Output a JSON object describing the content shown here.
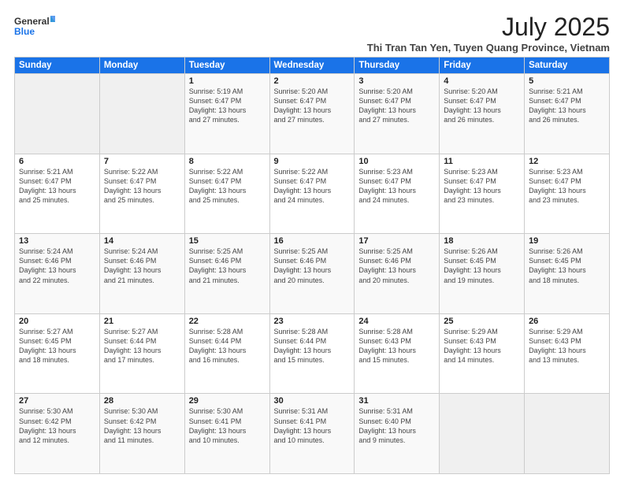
{
  "header": {
    "logo_line1": "General",
    "logo_line2": "Blue",
    "month_year": "July 2025",
    "location": "Thi Tran Tan Yen, Tuyen Quang Province, Vietnam"
  },
  "days_of_week": [
    "Sunday",
    "Monday",
    "Tuesday",
    "Wednesday",
    "Thursday",
    "Friday",
    "Saturday"
  ],
  "weeks": [
    [
      {
        "num": "",
        "info": ""
      },
      {
        "num": "",
        "info": ""
      },
      {
        "num": "1",
        "info": "Sunrise: 5:19 AM\nSunset: 6:47 PM\nDaylight: 13 hours\nand 27 minutes."
      },
      {
        "num": "2",
        "info": "Sunrise: 5:20 AM\nSunset: 6:47 PM\nDaylight: 13 hours\nand 27 minutes."
      },
      {
        "num": "3",
        "info": "Sunrise: 5:20 AM\nSunset: 6:47 PM\nDaylight: 13 hours\nand 27 minutes."
      },
      {
        "num": "4",
        "info": "Sunrise: 5:20 AM\nSunset: 6:47 PM\nDaylight: 13 hours\nand 26 minutes."
      },
      {
        "num": "5",
        "info": "Sunrise: 5:21 AM\nSunset: 6:47 PM\nDaylight: 13 hours\nand 26 minutes."
      }
    ],
    [
      {
        "num": "6",
        "info": "Sunrise: 5:21 AM\nSunset: 6:47 PM\nDaylight: 13 hours\nand 25 minutes."
      },
      {
        "num": "7",
        "info": "Sunrise: 5:22 AM\nSunset: 6:47 PM\nDaylight: 13 hours\nand 25 minutes."
      },
      {
        "num": "8",
        "info": "Sunrise: 5:22 AM\nSunset: 6:47 PM\nDaylight: 13 hours\nand 25 minutes."
      },
      {
        "num": "9",
        "info": "Sunrise: 5:22 AM\nSunset: 6:47 PM\nDaylight: 13 hours\nand 24 minutes."
      },
      {
        "num": "10",
        "info": "Sunrise: 5:23 AM\nSunset: 6:47 PM\nDaylight: 13 hours\nand 24 minutes."
      },
      {
        "num": "11",
        "info": "Sunrise: 5:23 AM\nSunset: 6:47 PM\nDaylight: 13 hours\nand 23 minutes."
      },
      {
        "num": "12",
        "info": "Sunrise: 5:23 AM\nSunset: 6:47 PM\nDaylight: 13 hours\nand 23 minutes."
      }
    ],
    [
      {
        "num": "13",
        "info": "Sunrise: 5:24 AM\nSunset: 6:46 PM\nDaylight: 13 hours\nand 22 minutes."
      },
      {
        "num": "14",
        "info": "Sunrise: 5:24 AM\nSunset: 6:46 PM\nDaylight: 13 hours\nand 21 minutes."
      },
      {
        "num": "15",
        "info": "Sunrise: 5:25 AM\nSunset: 6:46 PM\nDaylight: 13 hours\nand 21 minutes."
      },
      {
        "num": "16",
        "info": "Sunrise: 5:25 AM\nSunset: 6:46 PM\nDaylight: 13 hours\nand 20 minutes."
      },
      {
        "num": "17",
        "info": "Sunrise: 5:25 AM\nSunset: 6:46 PM\nDaylight: 13 hours\nand 20 minutes."
      },
      {
        "num": "18",
        "info": "Sunrise: 5:26 AM\nSunset: 6:45 PM\nDaylight: 13 hours\nand 19 minutes."
      },
      {
        "num": "19",
        "info": "Sunrise: 5:26 AM\nSunset: 6:45 PM\nDaylight: 13 hours\nand 18 minutes."
      }
    ],
    [
      {
        "num": "20",
        "info": "Sunrise: 5:27 AM\nSunset: 6:45 PM\nDaylight: 13 hours\nand 18 minutes."
      },
      {
        "num": "21",
        "info": "Sunrise: 5:27 AM\nSunset: 6:44 PM\nDaylight: 13 hours\nand 17 minutes."
      },
      {
        "num": "22",
        "info": "Sunrise: 5:28 AM\nSunset: 6:44 PM\nDaylight: 13 hours\nand 16 minutes."
      },
      {
        "num": "23",
        "info": "Sunrise: 5:28 AM\nSunset: 6:44 PM\nDaylight: 13 hours\nand 15 minutes."
      },
      {
        "num": "24",
        "info": "Sunrise: 5:28 AM\nSunset: 6:43 PM\nDaylight: 13 hours\nand 15 minutes."
      },
      {
        "num": "25",
        "info": "Sunrise: 5:29 AM\nSunset: 6:43 PM\nDaylight: 13 hours\nand 14 minutes."
      },
      {
        "num": "26",
        "info": "Sunrise: 5:29 AM\nSunset: 6:43 PM\nDaylight: 13 hours\nand 13 minutes."
      }
    ],
    [
      {
        "num": "27",
        "info": "Sunrise: 5:30 AM\nSunset: 6:42 PM\nDaylight: 13 hours\nand 12 minutes."
      },
      {
        "num": "28",
        "info": "Sunrise: 5:30 AM\nSunset: 6:42 PM\nDaylight: 13 hours\nand 11 minutes."
      },
      {
        "num": "29",
        "info": "Sunrise: 5:30 AM\nSunset: 6:41 PM\nDaylight: 13 hours\nand 10 minutes."
      },
      {
        "num": "30",
        "info": "Sunrise: 5:31 AM\nSunset: 6:41 PM\nDaylight: 13 hours\nand 10 minutes."
      },
      {
        "num": "31",
        "info": "Sunrise: 5:31 AM\nSunset: 6:40 PM\nDaylight: 13 hours\nand 9 minutes."
      },
      {
        "num": "",
        "info": ""
      },
      {
        "num": "",
        "info": ""
      }
    ]
  ]
}
